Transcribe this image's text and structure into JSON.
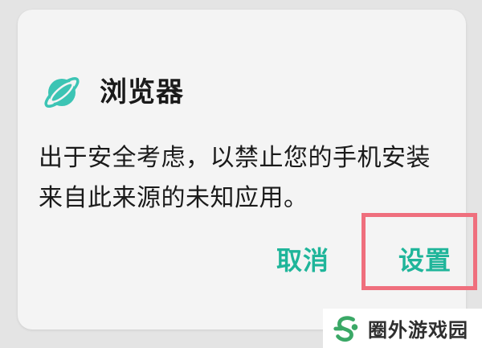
{
  "dialog": {
    "app_name": "浏览器",
    "message_line1": "出于安全考虑，以禁止您的手机安装",
    "message_line2": "来自此来源的未知应用。",
    "cancel_label": "取消",
    "settings_label": "设置"
  },
  "watermark": {
    "text": "圈外游戏园"
  },
  "colors": {
    "accent": "#1fb59a",
    "app_icon": "#3cc4b4",
    "highlight": "#ef6f7d",
    "dialog_bg": "#f4f4f4"
  },
  "icons": {
    "app_icon": "planet-icon",
    "watermark_logo": "s-logo-icon"
  }
}
